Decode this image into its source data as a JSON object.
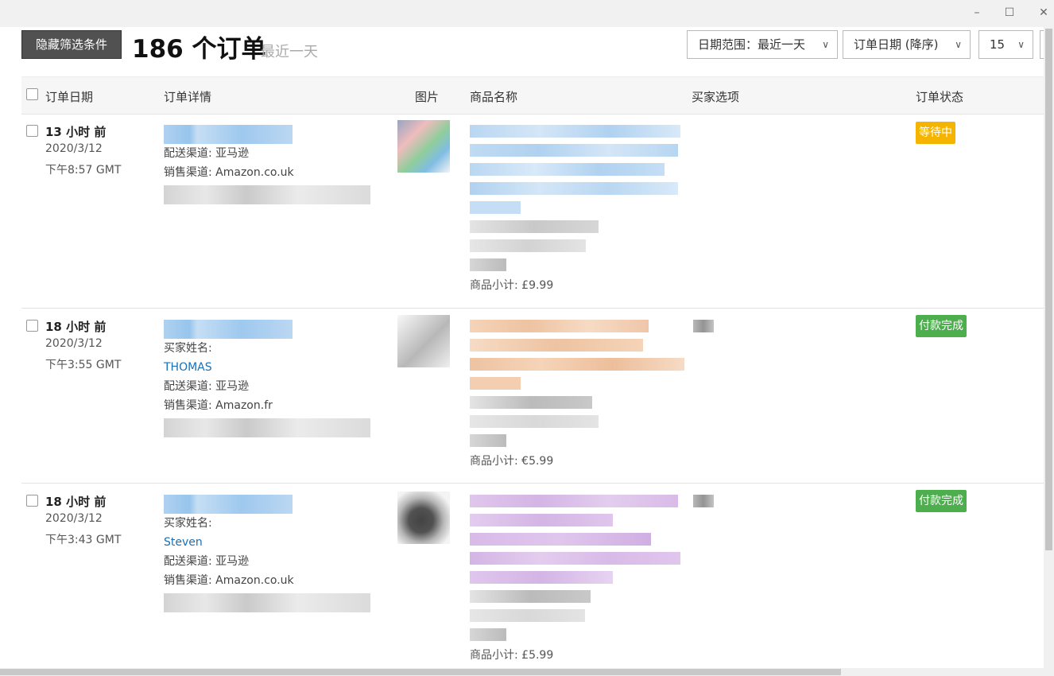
{
  "window": {
    "minimize": "–",
    "maximize": "☐",
    "close": "✕"
  },
  "toolbar": {
    "hide_filters_label": "隐藏筛选条件",
    "order_count": "186 个订单",
    "range_hint": "最近一天",
    "date_range_label": "日期范围：最近一天",
    "sort_label": "订单日期 (降序)",
    "per_page": "15"
  },
  "table": {
    "headers": [
      "订单日期",
      "订单详情",
      "图片",
      "商品名称",
      "买家选项",
      "订单状态"
    ],
    "rows": [
      {
        "time_ago": "13 小时 前",
        "date": "2020/3/12",
        "time": "下午8:57 GMT",
        "buyer_label": "",
        "buyer_name": "",
        "shipping": "配送渠道: 亚马逊",
        "channel": "销售渠道: Amazon.co.uk",
        "subtotal": "商品小计: £9.99",
        "status": "等待中",
        "status_color": "#f5b400"
      },
      {
        "time_ago": "18 小时 前",
        "date": "2020/3/12",
        "time": "下午3:55 GMT",
        "buyer_label": "买家姓名:",
        "buyer_name": "THOMAS",
        "shipping": "配送渠道: 亚马逊",
        "channel": "销售渠道: Amazon.fr",
        "subtotal": "商品小计: €5.99",
        "status": "付款完成",
        "status_color": "#4cae4c"
      },
      {
        "time_ago": "18 小时 前",
        "date": "2020/3/12",
        "time": "下午3:43 GMT",
        "buyer_label": "买家姓名:",
        "buyer_name": "Steven",
        "shipping": "配送渠道: 亚马逊",
        "channel": "销售渠道: Amazon.co.uk",
        "subtotal": "商品小计: £5.99",
        "status": "付款完成",
        "status_color": "#4cae4c"
      }
    ]
  }
}
